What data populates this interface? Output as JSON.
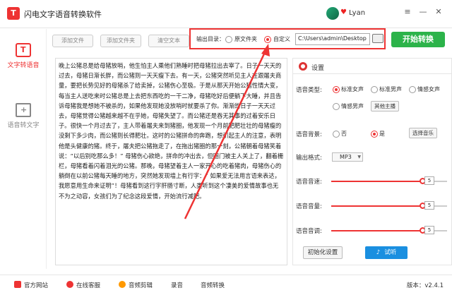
{
  "app": {
    "title": "闪电文字语音转换软件",
    "logo_letter": "T",
    "user_name": "Lyan",
    "version": "版本：v2.4.1"
  },
  "sidebar": {
    "items": [
      {
        "label": "文字转语音",
        "icon": "text-to-speech-icon"
      },
      {
        "label": "语音转文字",
        "icon": "speech-to-text-icon"
      }
    ]
  },
  "toolbar": {
    "add_file": "添加文件",
    "add_folder": "添加文件夹",
    "clear_files": "清空文本",
    "output_label": "输出目录：",
    "option_source": "原文件夹",
    "option_custom": "自定义",
    "output_path": "C:\\Users\\admin\\Desktop",
    "start_button": "开始转换"
  },
  "content_text": "晚上公猪总是给母猪放哨，他生怕主人乘他们熟睡时把母猪拉出去宰了。日子一天天的过去，母猪日渐长胖，而公猪则一天天瘦下去。有一天，公猪突然听见主人在跟屠夫商量，要把长势见好的母猪杀了给卖掉，公猪伤心至极。于是从那天开始公猪性情大变，每当主人送吃来时公猪总是上去把东西吃的一干二净，母猪吃好后便躺下大睡，并且告诉母猪我是想她不被杀的，如果他发现她没放哨时就要杀了你。渐渐的日子一天天过去，母猪觉得公猪越来越不在乎她，母猪失望了。而公猪还是吞无其事的过着安乐日子。很快一个月过去了，主人带着屠夫来到猪圈，他发现一个月前肥肥壮壮的母猪瘦的没剩下多少肉，而公猪则长得肥壮。这时的公猪拼命的奔跑，想引起主人的注意，表明他是头健康的猪。终于，屠夫把公猪拖走了，在拖出猪圈的那一刻，公猪朝着母猪笑着说：“以后别吃那么多！”  母猪伤心欲绝，拼命的冲出去，但圈门被主人关上了，翻着栅栏，母猪看着闪着泪光的公猪。那晚，母猪望着主人一家开心的吃着猪肉，母猪伤心的躺倒在以前公猪每天睡的地方，突然她发现墙上有行字：“  如果爱无法用言语来表达，我愿意用生命来证明”！母猪看到这行字肝肠寸断，人类听到这个凄美的爱情故事也无不为之动容，女孩们为了纪念这段爱情，开始流行减肥。",
  "settings": {
    "title": "设置",
    "voice_type_label": "语音类型:",
    "voice_options": [
      "标准女声",
      "标准男声",
      "情感女声",
      "情感男声"
    ],
    "voice_selected": "标准女声",
    "other_voice_button": "其他主播",
    "bg_label": "语音背景:",
    "bg_options": [
      "否",
      "是"
    ],
    "bg_selected": "是",
    "choose_music_button": "选择音乐",
    "format_label": "输出格式:",
    "format_value": "MP3",
    "speed_label": "语音音速:",
    "speed_value": "5",
    "volume_label": "语音音量:",
    "volume_value": "5",
    "pitch_label": "语音音调:",
    "pitch_value": "5",
    "init_button": "初始化设置",
    "listen_button": "试听"
  },
  "bottom": {
    "items": [
      "官方网站",
      "在线客服",
      "音频剪辑",
      "录音",
      "音频转换"
    ]
  },
  "colors": {
    "accent": "#e33333",
    "start": "#2cb34a",
    "listen": "#1a8fe0"
  }
}
